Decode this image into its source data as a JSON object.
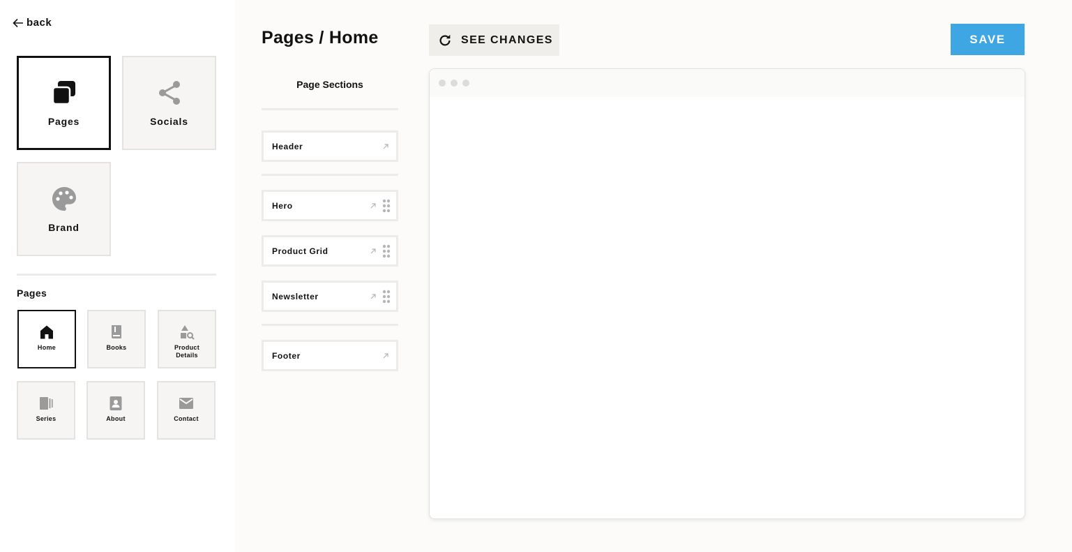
{
  "nav": {
    "back_label": "back"
  },
  "categories": [
    {
      "label": "Pages",
      "icon": "pages-icon",
      "active": true
    },
    {
      "label": "Socials",
      "icon": "share-icon",
      "active": false
    },
    {
      "label": "Brand",
      "icon": "palette-icon",
      "active": false
    }
  ],
  "pages_heading": "Pages",
  "pages": [
    {
      "label": "Home",
      "icon": "home-icon",
      "active": true
    },
    {
      "label": "Books",
      "icon": "book-icon",
      "active": false
    },
    {
      "label": "Product Details",
      "icon": "shapes-search-icon",
      "active": false
    },
    {
      "label": "Series",
      "icon": "library-books-icon",
      "active": false
    },
    {
      "label": "About",
      "icon": "contact-page-icon",
      "active": false
    },
    {
      "label": "Contact",
      "icon": "mail-icon",
      "active": false
    }
  ],
  "header": {
    "title": "Pages / Home",
    "see_changes_label": "SEE CHANGES",
    "save_label": "SAVE"
  },
  "sections_panel": {
    "heading": "Page Sections",
    "fixed_top": {
      "label": "Header"
    },
    "movable": [
      {
        "label": "Hero"
      },
      {
        "label": "Product Grid"
      },
      {
        "label": "Newsletter"
      }
    ],
    "fixed_bottom": {
      "label": "Footer"
    }
  },
  "colors": {
    "accent": "#3ea6e3",
    "active_border": "#111111",
    "tile_bg": "#f6f5f3",
    "icon_gray": "#9a9a9a"
  }
}
